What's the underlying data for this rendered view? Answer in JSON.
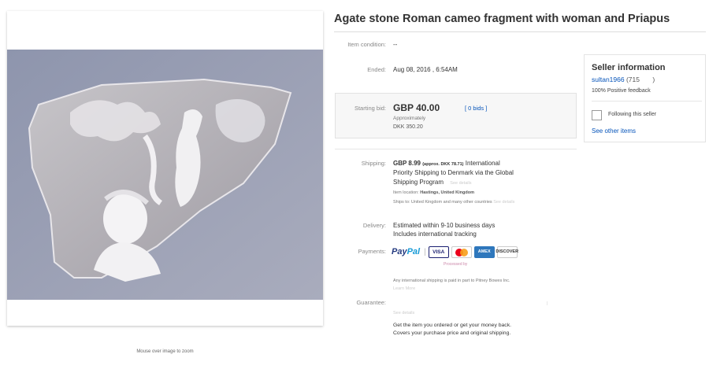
{
  "listing": {
    "title": "Agate stone Roman cameo fragment with woman and Priapus",
    "zoom_hint": "Mouse over image to zoom"
  },
  "details": {
    "condition": {
      "label": "Item condition:",
      "value": "--"
    },
    "ended": {
      "label": "Ended:",
      "value": "Aug 08, 2016 , 6:54AM"
    },
    "bid": {
      "label": "Starting bid:",
      "price": "GBP 40.00",
      "bids": "[ 0 bids ]",
      "approx_label": "Approximately",
      "approx_value": "DKK 350.20"
    },
    "shipping": {
      "label": "Shipping:",
      "cost": "GBP 8.99",
      "approx": "(approx. DKK 78.71)",
      "text1": "International",
      "text2": "Priority Shipping to Denmark  via the Global",
      "text3": "Shipping Program",
      "see_details": "See details",
      "location_label": "Item location:",
      "location_value": "Hastings, United Kingdom",
      "ships_to": "Ships to: United Kingdom and many other countries",
      "ships_to_link": "See details"
    },
    "delivery": {
      "label": "Delivery:",
      "line1": "Estimated within 9-10 business days",
      "line2": "Includes international tracking"
    },
    "payments": {
      "label": "Payments:",
      "paypal_pay": "Pay",
      "paypal_pal": "Pal",
      "visa": "VISA",
      "amex": "AMEX",
      "discover": "DISCOVER",
      "processed_by": "Processed by",
      "note": "Any international shipping is paid in part to Pitney Bowes Inc.",
      "learn_more": "Learn More"
    },
    "guarantee": {
      "label": "Guarantee:",
      "see_details": "See details",
      "line1": "Get the item you ordered or get your money back.",
      "line2": "Covers your purchase price and original shipping."
    }
  },
  "seller": {
    "title": "Seller information",
    "name": "sultan1966",
    "score": "(715",
    "star": ")",
    "feedback": "100% Positive feedback",
    "follow_label": "Following this seller",
    "see_other": "See other items"
  },
  "colors": {
    "link": "#0654ba",
    "paypal_dark": "#253b80",
    "paypal_light": "#179bd7"
  }
}
